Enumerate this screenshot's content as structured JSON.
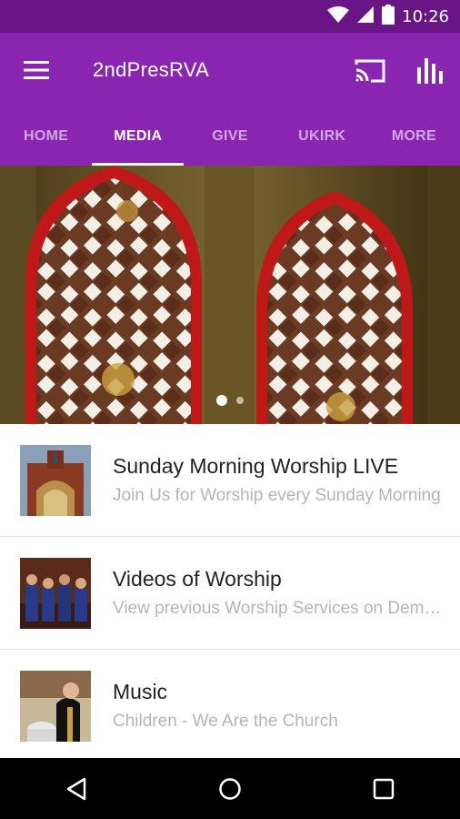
{
  "status_bar": {
    "time": "10:26",
    "icons": [
      "wifi-icon",
      "cell-signal-icon",
      "battery-icon"
    ]
  },
  "app_bar": {
    "title": "2ndPresRVA",
    "menu_icon": "hamburger-menu-icon",
    "actions": [
      "cast-icon",
      "equalizer-icon"
    ]
  },
  "tabs": [
    {
      "label": "HOME",
      "active": false
    },
    {
      "label": "MEDIA",
      "active": true
    },
    {
      "label": "GIVE",
      "active": false
    },
    {
      "label": "UKIRK",
      "active": false
    },
    {
      "label": "MORE",
      "active": false
    }
  ],
  "hero": {
    "slide_count": 2,
    "active_slide": 1
  },
  "media_list": [
    {
      "title": "Sunday Morning Worship LIVE",
      "subtitle": "Join Us for Worship every Sunday Morning",
      "thumb": "church-exterior"
    },
    {
      "title": "Videos of Worship",
      "subtitle": "View previous Worship Services on Demand",
      "thumb": "choir"
    },
    {
      "title": "Music",
      "subtitle": "Children - We Are the Church",
      "thumb": "pastor-baptism"
    }
  ],
  "colors": {
    "primary": "#8a25b1",
    "status_bar": "#6a1585",
    "title_text": "#222222",
    "subtitle_text": "#b5b5b5"
  },
  "nav_bar": [
    "back-icon",
    "home-icon",
    "recents-icon"
  ]
}
